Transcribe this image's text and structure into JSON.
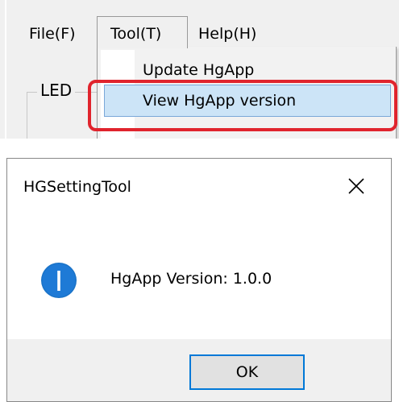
{
  "menubar": {
    "file_label": "File(F)",
    "tool_label": "Tool(T)",
    "help_label": "Help(H)"
  },
  "group": {
    "label": "LED"
  },
  "tool_menu": {
    "items": [
      {
        "label": "Update HgApp",
        "highlighted": false
      },
      {
        "label": "View HgApp version",
        "highlighted": true
      }
    ],
    "highlight_ring_color": "#e0242d"
  },
  "dialog": {
    "title": "HGSettingTool",
    "close_icon": "close-icon",
    "info_icon": "info-icon",
    "message": "HgApp Version: 1.0.0",
    "ok_label": "OK",
    "accent_color": "#0078d7"
  }
}
